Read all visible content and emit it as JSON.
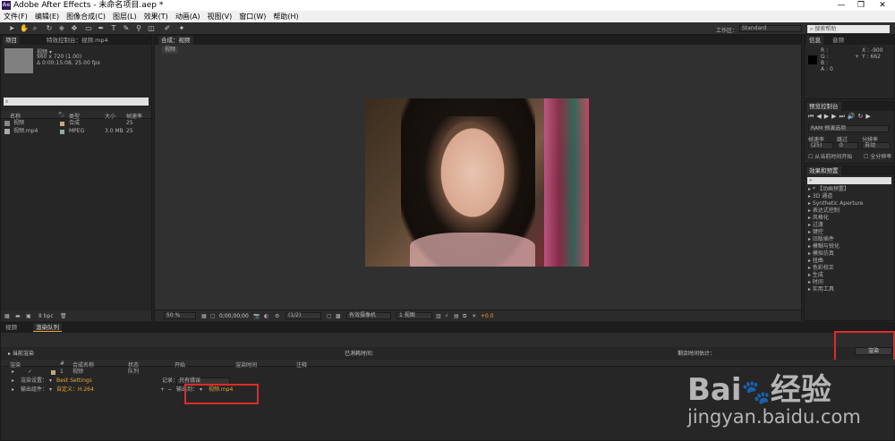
{
  "window": {
    "title": "Adobe After Effects - 未命名项目.aep *",
    "logo": "Ae",
    "min": "—",
    "max": "❐",
    "close": "✕"
  },
  "menu": [
    "文件(F)",
    "编辑(E)",
    "图像合成(C)",
    "图层(L)",
    "效果(T)",
    "动画(A)",
    "视图(V)",
    "窗口(W)",
    "帮助(H)"
  ],
  "toolbar": {
    "workspace_label": "工作区：",
    "workspace_value": "Standard",
    "search_placeholder": "搜索帮助"
  },
  "project": {
    "tabs": [
      "项目",
      "特效控制台：视频.mp4"
    ],
    "item_name": "视频 ▾",
    "item_info1": "960 x 720 (1.00)",
    "item_info2": "Δ 0:00:15:08, 25.00 fps",
    "search_placeholder": "",
    "columns": [
      "名称",
      "类型",
      "大小",
      "帧速率"
    ],
    "rows": [
      {
        "name": "视频",
        "type": "合成",
        "size": "",
        "fps": "25"
      },
      {
        "name": "视频.mp4",
        "type": "MPEG",
        "size": "3.0 MB",
        "fps": "25"
      }
    ],
    "bpc": "8 bpc"
  },
  "composition": {
    "tab": "合成：视频",
    "sub_tab": "视频",
    "footer": {
      "zoom": "50 %",
      "time": "0;00;00;00",
      "res": "(1/2)",
      "camera": "有效摄像机",
      "view": "1 视图",
      "exposure": "+0.0"
    }
  },
  "info": {
    "tabs": [
      "信息",
      "音频"
    ],
    "r": "R :",
    "g": "G :",
    "b": "B :",
    "a": "A : 0",
    "x": "X : -900",
    "y": "Y : 662"
  },
  "preview": {
    "tab": "预览控制台",
    "ram_label": "RAM 预演选项",
    "frame_rate_label": "帧速率",
    "skip_label": "跳过",
    "resolution_label": "分辨率",
    "frame_rate": "(25)",
    "skip": "0",
    "resolution": "自动",
    "opt1": "从当前时间开始",
    "opt2": "全分辨率"
  },
  "effects": {
    "tab": "效果和预置",
    "items": [
      "* 【动画预置】",
      "3D 通道",
      "Synthetic Aperture",
      "表达式控制",
      "风格化",
      "过渡",
      "键控",
      "旧版插件",
      "模糊与锐化",
      "模拟仿真",
      "扭曲",
      "色彩校正",
      "生成",
      "时间",
      "实用工具"
    ]
  },
  "timeline": {
    "tabs": [
      "视频",
      "渲染队列"
    ],
    "current_render": "当前渲染",
    "elapsed": "已消耗时间：",
    "remaining": "剩余时间估计：",
    "render_button": "渲染",
    "columns": [
      "渲染",
      "#",
      "合成名称",
      "状态",
      "开始",
      "渲染时间",
      "注释"
    ],
    "row": {
      "index": "1",
      "name": "视频",
      "status": "队列"
    },
    "settings_label": "渲染设置：",
    "settings_value": "Best Settings",
    "log_label": "记录：",
    "log_value": "只有错误",
    "output_module_label": "输出组件：",
    "output_module_value": "自定义：H.264",
    "output_to_label": "输出到：",
    "output_to_value": "视频.mp4"
  },
  "watermark": {
    "brand": "Bai",
    "brand2": "经验",
    "url": "jingyan.baidu.com"
  }
}
